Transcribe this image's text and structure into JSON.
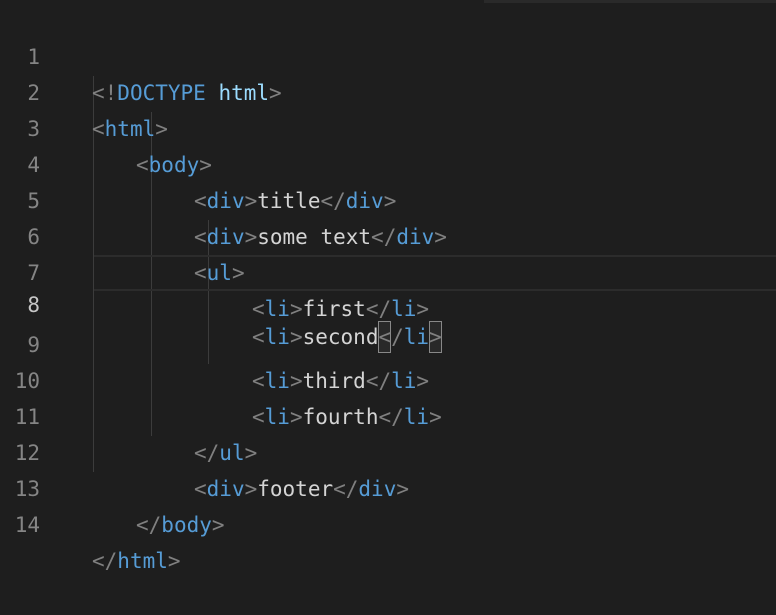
{
  "editor": {
    "lines": [
      {
        "num": "1",
        "open": "<!",
        "tag": "DOCTYPE",
        "sp": " ",
        "attr": "html",
        "close": ">"
      },
      {
        "num": "2",
        "lt": "<",
        "tag": "html",
        "gt": ">"
      },
      {
        "num": "3",
        "lt": "<",
        "tag": "body",
        "gt": ">"
      },
      {
        "num": "4",
        "lt": "<",
        "tag": "div",
        "gt": ">",
        "text": "title",
        "clt": "</",
        "ctag": "div",
        "cgt": ">"
      },
      {
        "num": "5",
        "lt": "<",
        "tag": "div",
        "gt": ">",
        "text": "some text",
        "clt": "</",
        "ctag": "div",
        "cgt": ">"
      },
      {
        "num": "6",
        "lt": "<",
        "tag": "ul",
        "gt": ">"
      },
      {
        "num": "7",
        "lt": "<",
        "tag": "li",
        "gt": ">",
        "text": "first",
        "clt": "</",
        "ctag": "li",
        "cgt": ">"
      },
      {
        "num": "8",
        "lt": "<",
        "tag": "li",
        "gt": ">",
        "text": "second",
        "clt1": "<",
        "clt2": "/",
        "ctag": "li",
        "cgt": ">"
      },
      {
        "num": "9",
        "lt": "<",
        "tag": "li",
        "gt": ">",
        "text": "third",
        "clt": "</",
        "ctag": "li",
        "cgt": ">"
      },
      {
        "num": "10",
        "lt": "<",
        "tag": "li",
        "gt": ">",
        "text": "fourth",
        "clt": "</",
        "ctag": "li",
        "cgt": ">"
      },
      {
        "num": "11",
        "clt": "</",
        "ctag": "ul",
        "cgt": ">"
      },
      {
        "num": "12",
        "lt": "<",
        "tag": "div",
        "gt": ">",
        "text": "footer",
        "clt": "</",
        "ctag": "div",
        "cgt": ">"
      },
      {
        "num": "13",
        "clt": "</",
        "ctag": "body",
        "cgt": ">"
      },
      {
        "num": "14",
        "clt": "</",
        "ctag": "html",
        "cgt": ">"
      }
    ]
  },
  "colors": {
    "background": "#1e1e1e",
    "tag": "#569cd6",
    "bracket": "#808080",
    "text": "#d4d4d4",
    "line_number": "#858585",
    "line_number_active": "#c6c6c6"
  }
}
